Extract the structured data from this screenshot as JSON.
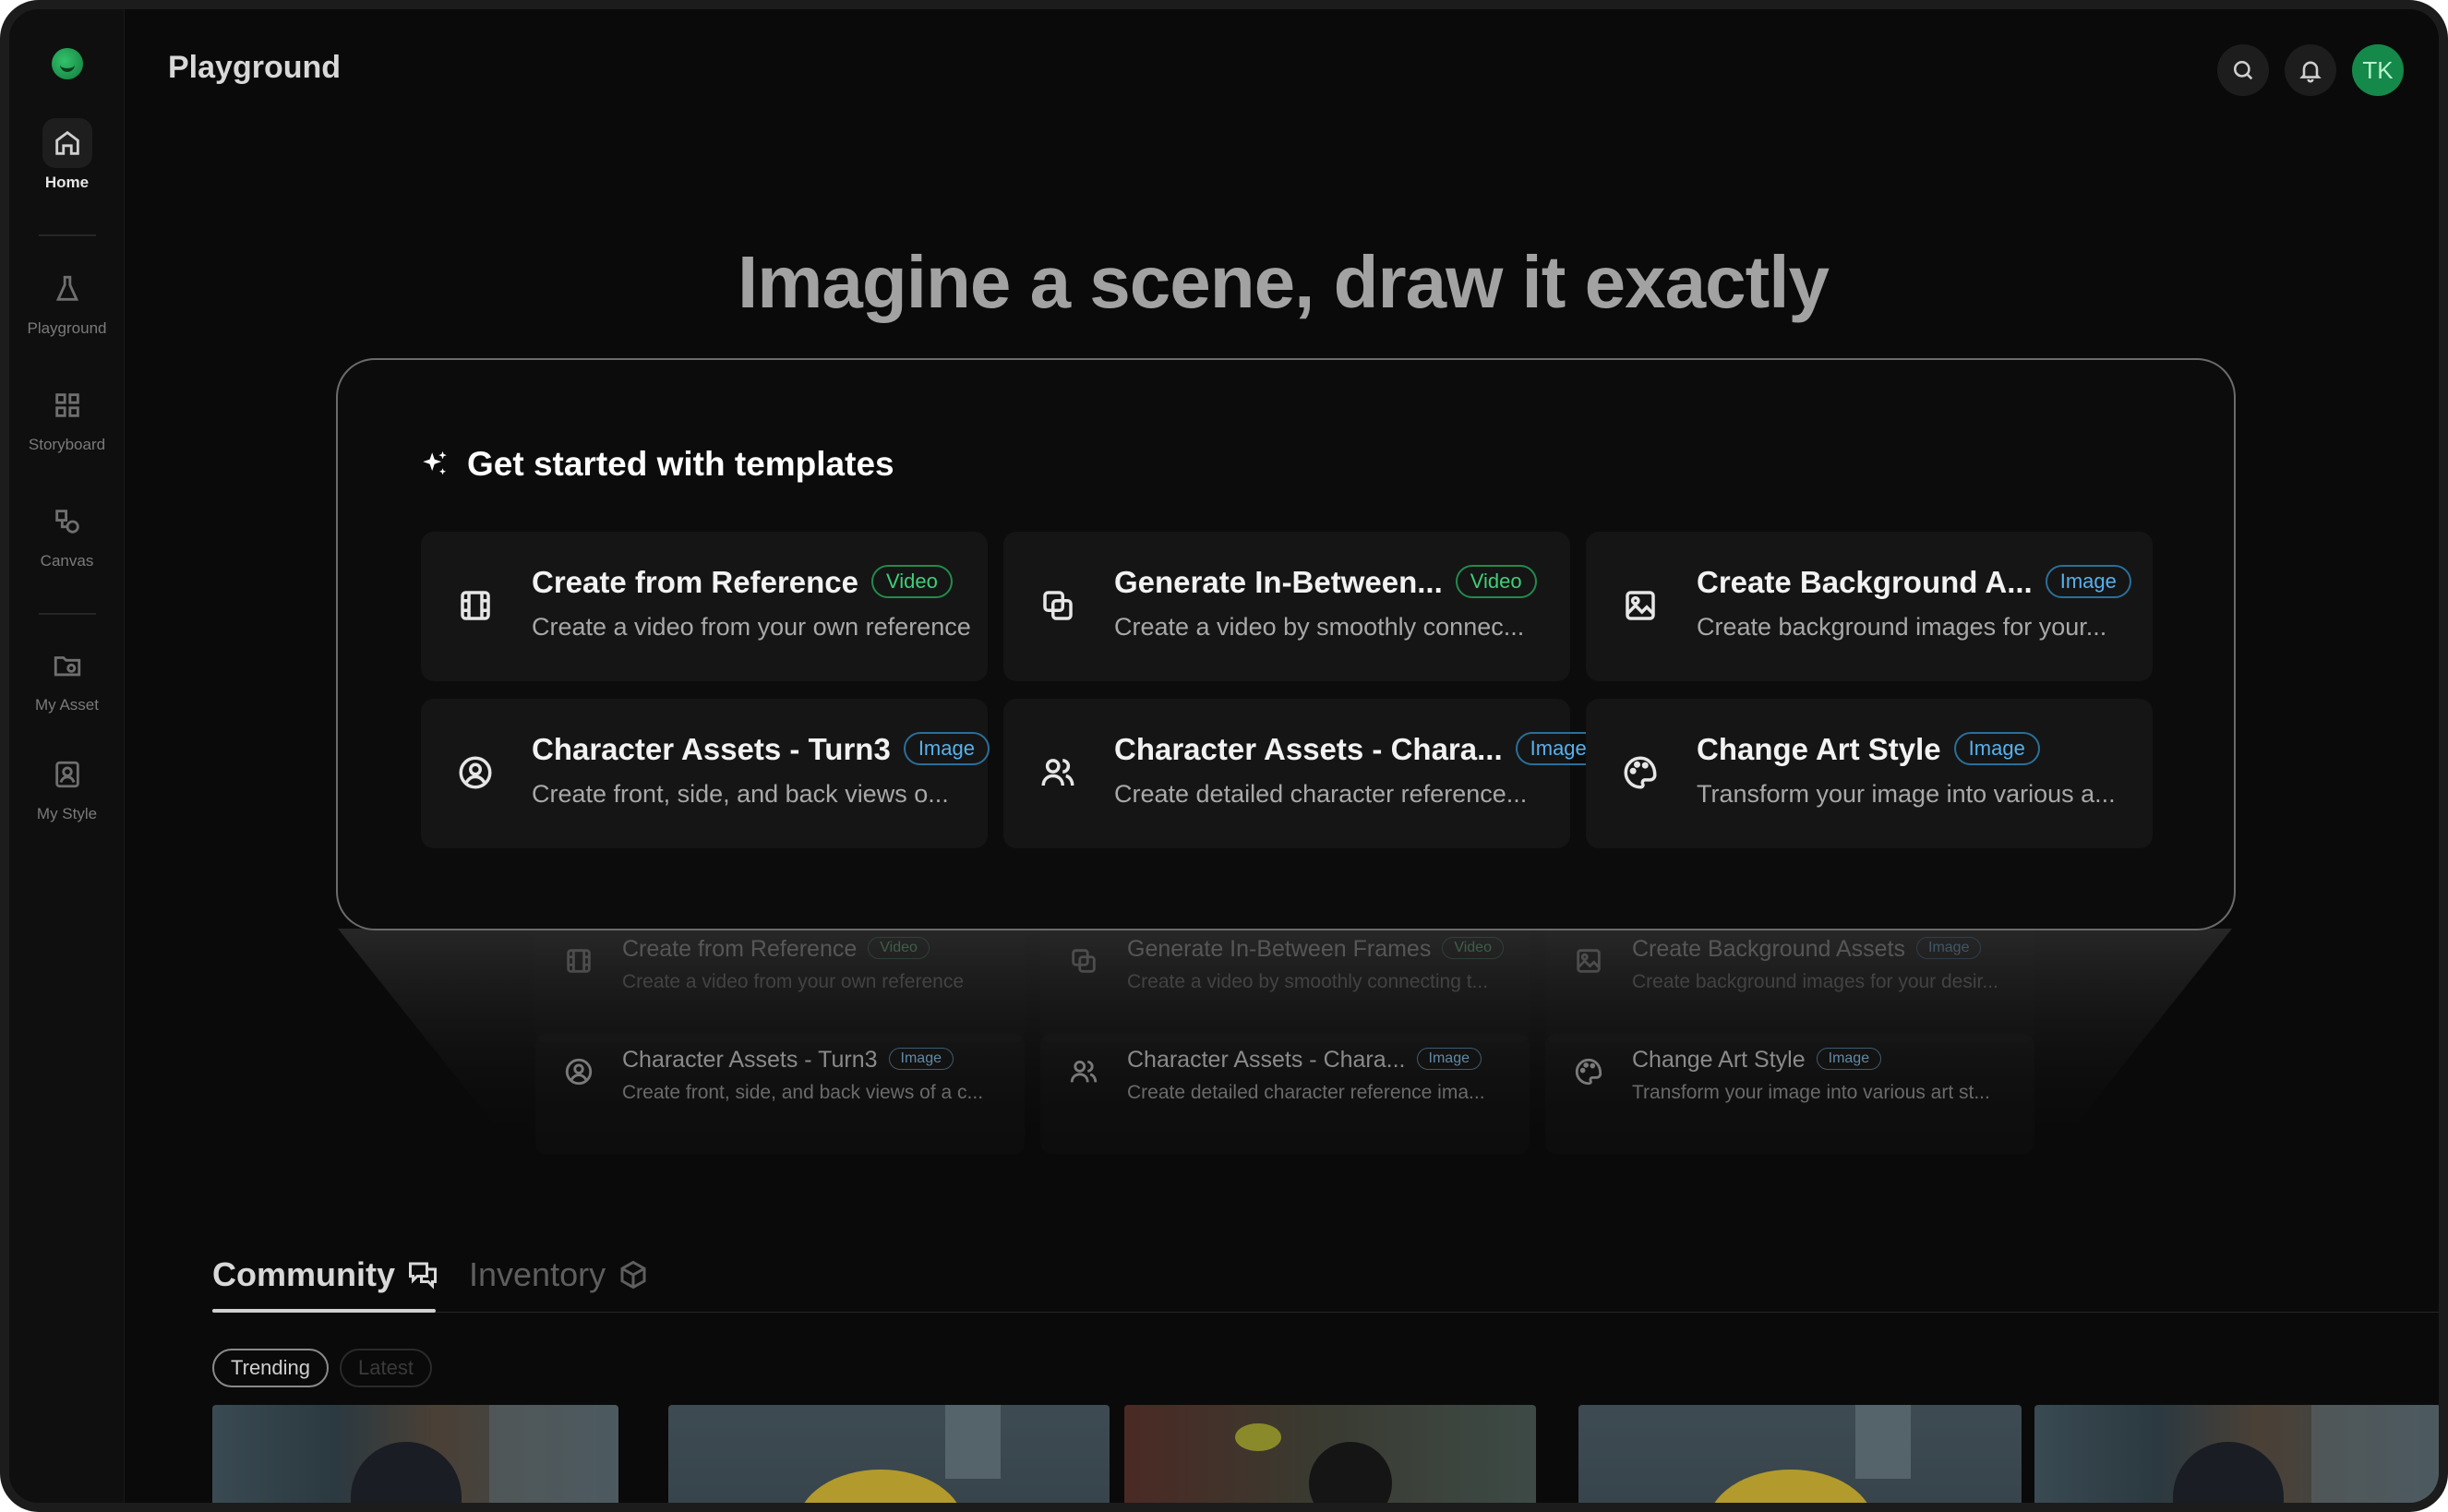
{
  "app": {
    "title": "Playground"
  },
  "sidebar": {
    "items": [
      {
        "label": "Home",
        "icon": "home-icon",
        "active": true
      },
      {
        "label": "Playground",
        "icon": "flask-icon"
      },
      {
        "label": "Storyboard",
        "icon": "grid-icon"
      },
      {
        "label": "Canvas",
        "icon": "shapes-icon"
      },
      {
        "label": "My Asset",
        "icon": "folder-icon"
      },
      {
        "label": "My Style",
        "icon": "portrait-icon"
      }
    ]
  },
  "header": {
    "search_icon": "search-icon",
    "bell_icon": "bell-icon",
    "avatar_initials": "TK",
    "avatar_color": "#14894a"
  },
  "hero": {
    "headline": "Imagine a scene, draw it exactly"
  },
  "templates": {
    "heading": "Get started with templates",
    "cards": [
      {
        "title": "Create from Reference",
        "tag": "Video",
        "desc": "Create a video from your own reference",
        "icon": "film-icon"
      },
      {
        "title": "Generate In-Between...",
        "tag": "Video",
        "desc": "Create a video by smoothly connec...",
        "icon": "layers-icon"
      },
      {
        "title": "Create Background A...",
        "tag": "Image",
        "desc": "Create background images for your...",
        "icon": "image-icon"
      },
      {
        "title": "Character Assets - Turn3",
        "tag": "Image",
        "desc": "Create front, side, and back views o...",
        "icon": "user-circle-icon"
      },
      {
        "title": "Character Assets - Chara...",
        "tag": "Image",
        "desc": "Create detailed character reference...",
        "icon": "users-icon"
      },
      {
        "title": "Change Art Style",
        "tag": "Image",
        "desc": "Transform your image into various a...",
        "icon": "palette-icon"
      }
    ]
  },
  "ghost_templates": {
    "cards": [
      {
        "title": "Create from Reference",
        "tag": "Video",
        "desc": "Create a video from your own reference"
      },
      {
        "title": "Generate In-Between Frames",
        "tag": "Video",
        "desc": "Create a video by smoothly connecting t..."
      },
      {
        "title": "Create Background Assets",
        "tag": "Image",
        "desc": "Create background images for your desir..."
      },
      {
        "title": "Character Assets - Turn3",
        "tag": "Image",
        "desc": "Create front, side, and back views of a c..."
      },
      {
        "title": "Character Assets - Chara...",
        "tag": "Image",
        "desc": "Create detailed character reference ima..."
      },
      {
        "title": "Change Art Style",
        "tag": "Image",
        "desc": "Transform your image into various art st..."
      }
    ]
  },
  "community": {
    "tabs": [
      {
        "label": "Community",
        "icon": "chat-icon",
        "active": true
      },
      {
        "label": "Inventory",
        "icon": "box-icon"
      }
    ],
    "filters": [
      {
        "label": "Trending",
        "active": true
      },
      {
        "label": "Latest"
      }
    ]
  },
  "colors": {
    "video_tag": "#3ecf78",
    "image_tag": "#56b2ee",
    "accent": "#14894a"
  }
}
